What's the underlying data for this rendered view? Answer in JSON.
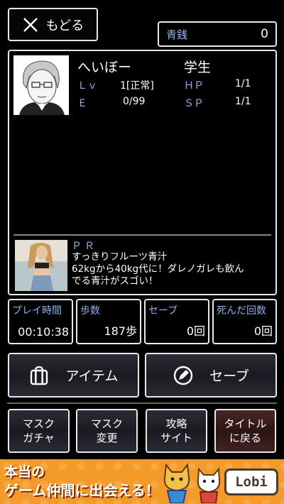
{
  "header": {
    "back_label": "もどる",
    "currency_label": "青銭",
    "currency_value": "0"
  },
  "character": {
    "name": "へいぼー",
    "class": "学生",
    "lv_label": "Ｌｖ",
    "lv_value": "1[正常]",
    "hp_label": "ＨＰ",
    "hp_value": "1/1",
    "e_label": "Ｅ",
    "e_value": "0/99",
    "sp_label": "ＳＰ",
    "sp_value": "1/1"
  },
  "pr": {
    "label": "ＰＲ",
    "line1": "すっきりフルーツ青汁",
    "line2": "62kgから40kg代に！ダレノガレも飲ん",
    "line3": "でる青汁がスゴい！"
  },
  "stats": {
    "playtime_label": "プレイ時間",
    "playtime_value": "00:10:38",
    "steps_label": "歩数",
    "steps_value": "187歩",
    "saves_label": "セーブ",
    "saves_value": "0回",
    "deaths_label": "死んだ回数",
    "deaths_value": "0回"
  },
  "actions": {
    "item_label": "アイテム",
    "save_label": "セーブ"
  },
  "menu": {
    "mask_gacha_1": "マスク",
    "mask_gacha_2": "ガチャ",
    "mask_change_1": "マスク",
    "mask_change_2": "変更",
    "guide_1": "攻略",
    "guide_2": "サイト",
    "title_1": "タイトル",
    "title_2": "に戻る"
  },
  "ad": {
    "line1": "本当の",
    "line2": "ゲーム仲間に出会える！",
    "brand": "Lobi"
  },
  "colors": {
    "label_blue": "#8fb0ee",
    "ad_orange": "#f39a2a"
  }
}
